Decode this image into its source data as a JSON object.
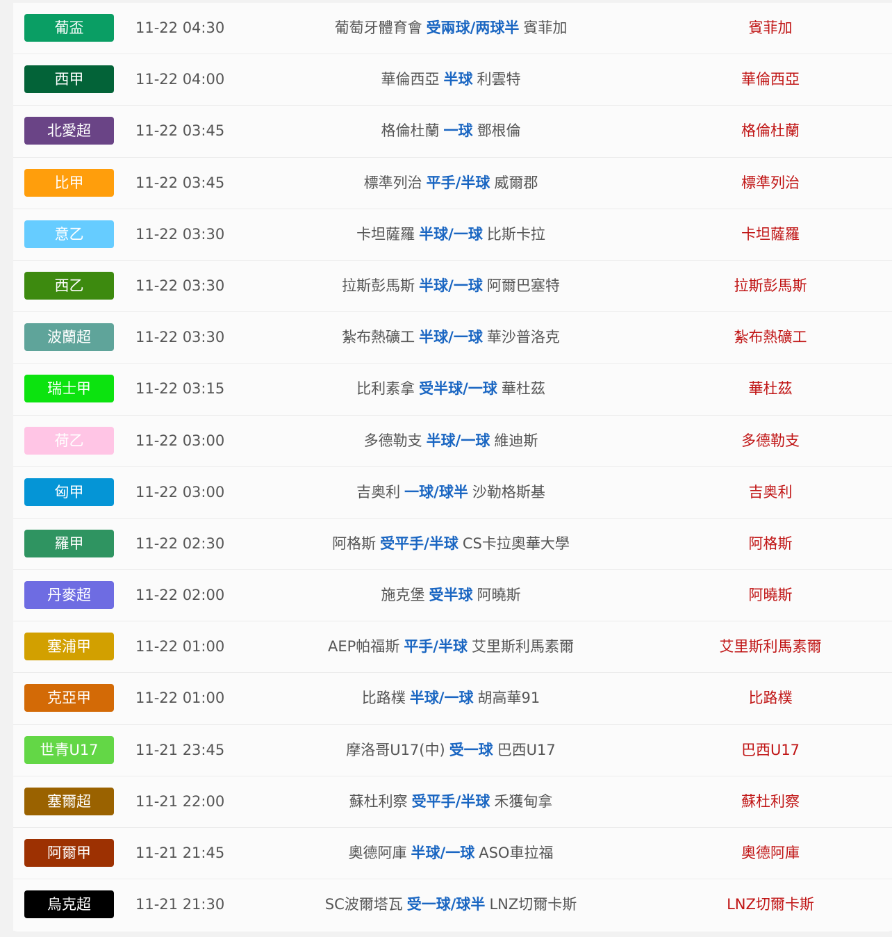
{
  "matches": [
    {
      "league": "葡盃",
      "badge_color": "#0a9e64",
      "time": "11-22 04:30",
      "home": "葡萄牙體育會",
      "handicap": "受兩球/两球半",
      "away": "賓菲加",
      "pick": "賓菲加"
    },
    {
      "league": "西甲",
      "badge_color": "#036338",
      "time": "11-22 04:00",
      "home": "華倫西亞",
      "handicap": "半球",
      "away": "利雲特",
      "pick": "華倫西亞"
    },
    {
      "league": "北愛超",
      "badge_color": "#6a4486",
      "time": "11-22 03:45",
      "home": "格倫杜蘭",
      "handicap": "一球",
      "away": "鄧根倫",
      "pick": "格倫杜蘭"
    },
    {
      "league": "比甲",
      "badge_color": "#ff9e0c",
      "time": "11-22 03:45",
      "home": "標準列治",
      "handicap": "平手/半球",
      "away": "威爾郡",
      "pick": "標準列治"
    },
    {
      "league": "意乙",
      "badge_color": "#66ccff",
      "time": "11-22 03:30",
      "home": "卡坦薩羅",
      "handicap": "半球/一球",
      "away": "比斯卡拉",
      "pick": "卡坦薩羅"
    },
    {
      "league": "西乙",
      "badge_color": "#3d8a0f",
      "time": "11-22 03:30",
      "home": "拉斯彭馬斯",
      "handicap": "半球/一球",
      "away": "阿爾巴塞特",
      "pick": "拉斯彭馬斯"
    },
    {
      "league": "波蘭超",
      "badge_color": "#5fa49a",
      "time": "11-22 03:30",
      "home": "紮布熱礦工",
      "handicap": "半球/一球",
      "away": "華沙普洛克",
      "pick": "紮布熱礦工"
    },
    {
      "league": "瑞士甲",
      "badge_color": "#0ce30f",
      "time": "11-22 03:15",
      "home": "比利素拿",
      "handicap": "受半球/一球",
      "away": "華杜茲",
      "pick": "華杜茲"
    },
    {
      "league": "荷乙",
      "badge_color": "#ffc5e5",
      "time": "11-22 03:00",
      "home": "多德勒支",
      "handicap": "半球/一球",
      "away": "維迪斯",
      "pick": "多德勒支"
    },
    {
      "league": "匈甲",
      "badge_color": "#0595d6",
      "time": "11-22 03:00",
      "home": "吉奥利",
      "handicap": "一球/球半",
      "away": "沙勒格斯基",
      "pick": "吉奥利"
    },
    {
      "league": "羅甲",
      "badge_color": "#2f9461",
      "time": "11-22 02:30",
      "home": "阿格斯",
      "handicap": "受平手/半球",
      "away": "CS卡拉奧華大學",
      "pick": "阿格斯"
    },
    {
      "league": "丹麥超",
      "badge_color": "#6e6ce2",
      "time": "11-22 02:00",
      "home": "施克堡",
      "handicap": "受半球",
      "away": "阿曉斯",
      "pick": "阿曉斯"
    },
    {
      "league": "塞浦甲",
      "badge_color": "#d2a000",
      "time": "11-22 01:00",
      "home": "AEP帕福斯",
      "handicap": "平手/半球",
      "away": "艾里斯利馬素爾",
      "pick": "艾里斯利馬素爾"
    },
    {
      "league": "克亞甲",
      "badge_color": "#d36a06",
      "time": "11-22 01:00",
      "home": "比路樸",
      "handicap": "半球/一球",
      "away": "胡高華91",
      "pick": "比路樸"
    },
    {
      "league": "世青U17",
      "badge_color": "#63d746",
      "time": "11-21 23:45",
      "home": "摩洛哥U17(中)",
      "handicap": "受一球",
      "away": "巴西U17",
      "pick": "巴西U17"
    },
    {
      "league": "塞爾超",
      "badge_color": "#9a6200",
      "time": "11-21 22:00",
      "home": "蘇杜利察",
      "handicap": "受平手/半球",
      "away": "禾獲甸拿",
      "pick": "蘇杜利察"
    },
    {
      "league": "阿爾甲",
      "badge_color": "#9d3102",
      "time": "11-21 21:45",
      "home": "奧德阿庫",
      "handicap": "半球/一球",
      "away": "ASO車拉福",
      "pick": "奧德阿庫"
    },
    {
      "league": "烏克超",
      "badge_color": "#000000",
      "time": "11-21 21:30",
      "home": "SC波爾塔瓦",
      "handicap": "受一球/球半",
      "away": "LNZ切爾卡斯",
      "pick": "LNZ切爾卡斯"
    }
  ]
}
